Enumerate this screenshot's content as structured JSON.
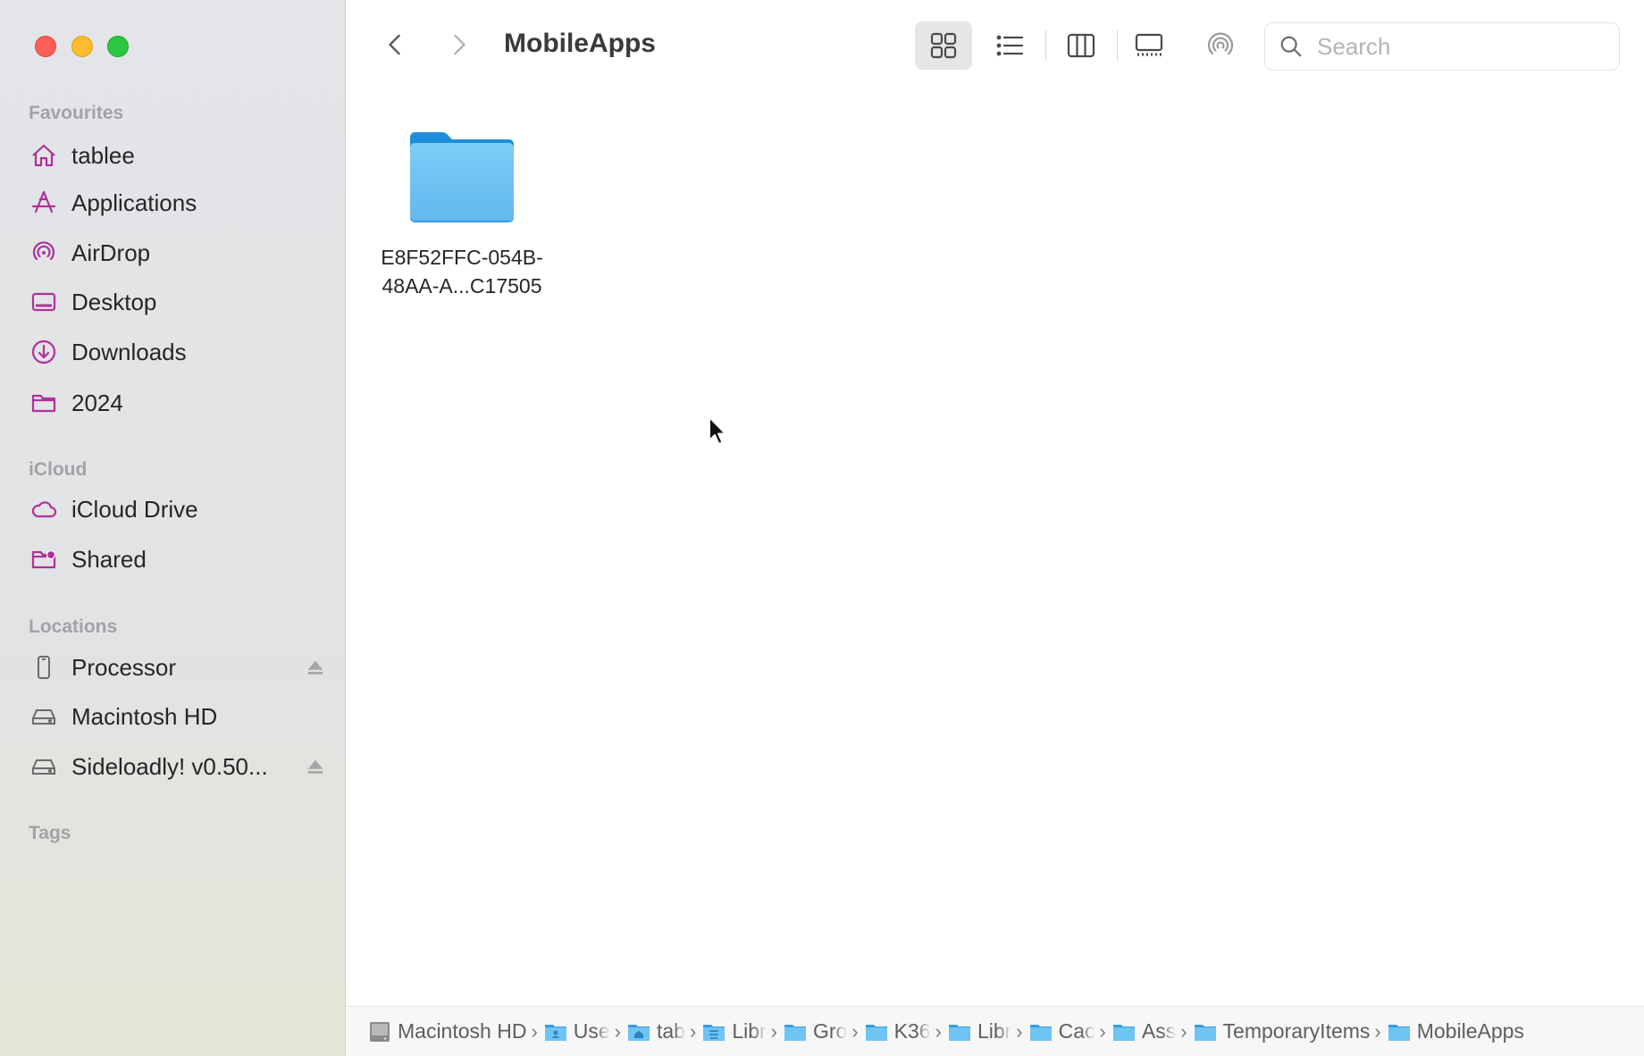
{
  "window": {
    "title": "MobileApps"
  },
  "sidebar": {
    "favourites_title": "Favourites",
    "favourites": [
      {
        "label": "tablee",
        "icon": "house-icon"
      },
      {
        "label": "Applications",
        "icon": "applications-icon"
      },
      {
        "label": "AirDrop",
        "icon": "airdrop-icon"
      },
      {
        "label": "Desktop",
        "icon": "desktop-icon"
      },
      {
        "label": "Downloads",
        "icon": "downloads-icon"
      },
      {
        "label": "2024",
        "icon": "folder-icon"
      }
    ],
    "icloud_title": "iCloud",
    "icloud": [
      {
        "label": "iCloud Drive",
        "icon": "cloud-icon"
      },
      {
        "label": "Shared",
        "icon": "shared-folder-icon"
      }
    ],
    "locations_title": "Locations",
    "locations": [
      {
        "label": "Processor",
        "icon": "phone-icon",
        "ejectable": true
      },
      {
        "label": "Macintosh HD",
        "icon": "drive-icon",
        "ejectable": false
      },
      {
        "label": "Sideloadly! v0.50...",
        "icon": "drive-icon",
        "ejectable": true
      }
    ],
    "tags_title": "Tags"
  },
  "toolbar": {
    "view_mode": "icon",
    "search_placeholder": "Search"
  },
  "content": {
    "items": [
      {
        "name": "E8F52FFC-054B-48AA-A...C17505",
        "kind": "folder"
      }
    ]
  },
  "pathbar": {
    "crumbs": [
      {
        "label": "Macintosh HD",
        "icon": "disk-icon"
      },
      {
        "label": "Use",
        "icon": "users-folder-icon"
      },
      {
        "label": "tab",
        "icon": "home-folder-icon"
      },
      {
        "label": "Libr",
        "icon": "library-folder-icon"
      },
      {
        "label": "Gro",
        "icon": "folder-icon"
      },
      {
        "label": "K36",
        "icon": "folder-icon"
      },
      {
        "label": "Libr",
        "icon": "folder-icon"
      },
      {
        "label": "Cac",
        "icon": "folder-icon"
      },
      {
        "label": "Ass",
        "icon": "folder-icon"
      },
      {
        "label": "TemporaryItems",
        "icon": "folder-icon"
      },
      {
        "label": "MobileApps",
        "icon": "folder-icon"
      }
    ]
  },
  "colors": {
    "sidebar_accent": "#b0309b",
    "folder_blue": "#6ec4f3",
    "close": "#fe5f57",
    "minimize": "#febc2e",
    "maximize": "#28c840"
  }
}
